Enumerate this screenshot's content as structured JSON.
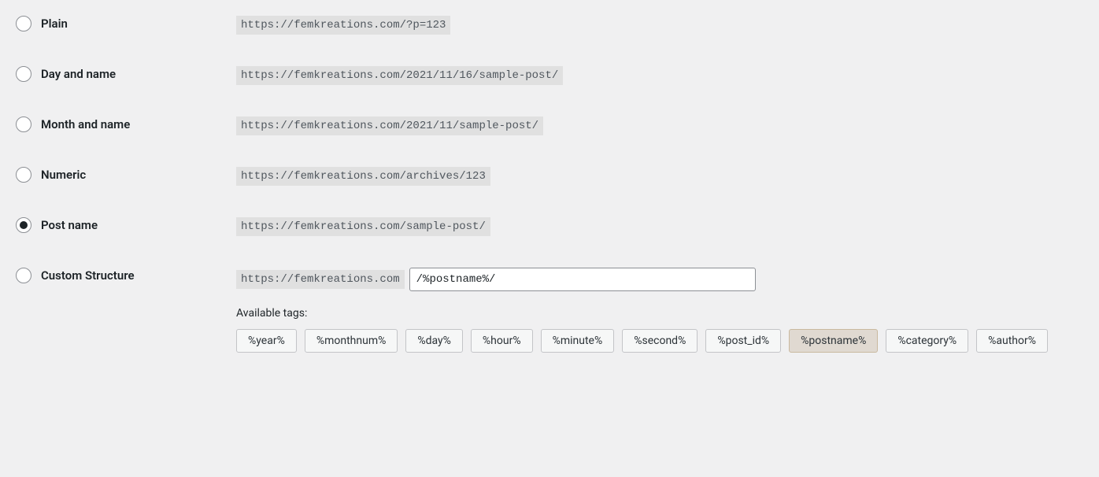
{
  "options": {
    "plain": {
      "label": "Plain",
      "example": "https://femkreations.com/?p=123"
    },
    "day_name": {
      "label": "Day and name",
      "example": "https://femkreations.com/2021/11/16/sample-post/"
    },
    "month_name": {
      "label": "Month and name",
      "example": "https://femkreations.com/2021/11/sample-post/"
    },
    "numeric": {
      "label": "Numeric",
      "example": "https://femkreations.com/archives/123"
    },
    "post_name": {
      "label": "Post name",
      "example": "https://femkreations.com/sample-post/"
    },
    "custom": {
      "label": "Custom Structure",
      "base_url": "https://femkreations.com",
      "input_value": "/%postname%/"
    }
  },
  "available_tags_label": "Available tags:",
  "tags": [
    "%year%",
    "%monthnum%",
    "%day%",
    "%hour%",
    "%minute%",
    "%second%",
    "%post_id%",
    "%postname%",
    "%category%",
    "%author%"
  ],
  "active_tag": "%postname%"
}
